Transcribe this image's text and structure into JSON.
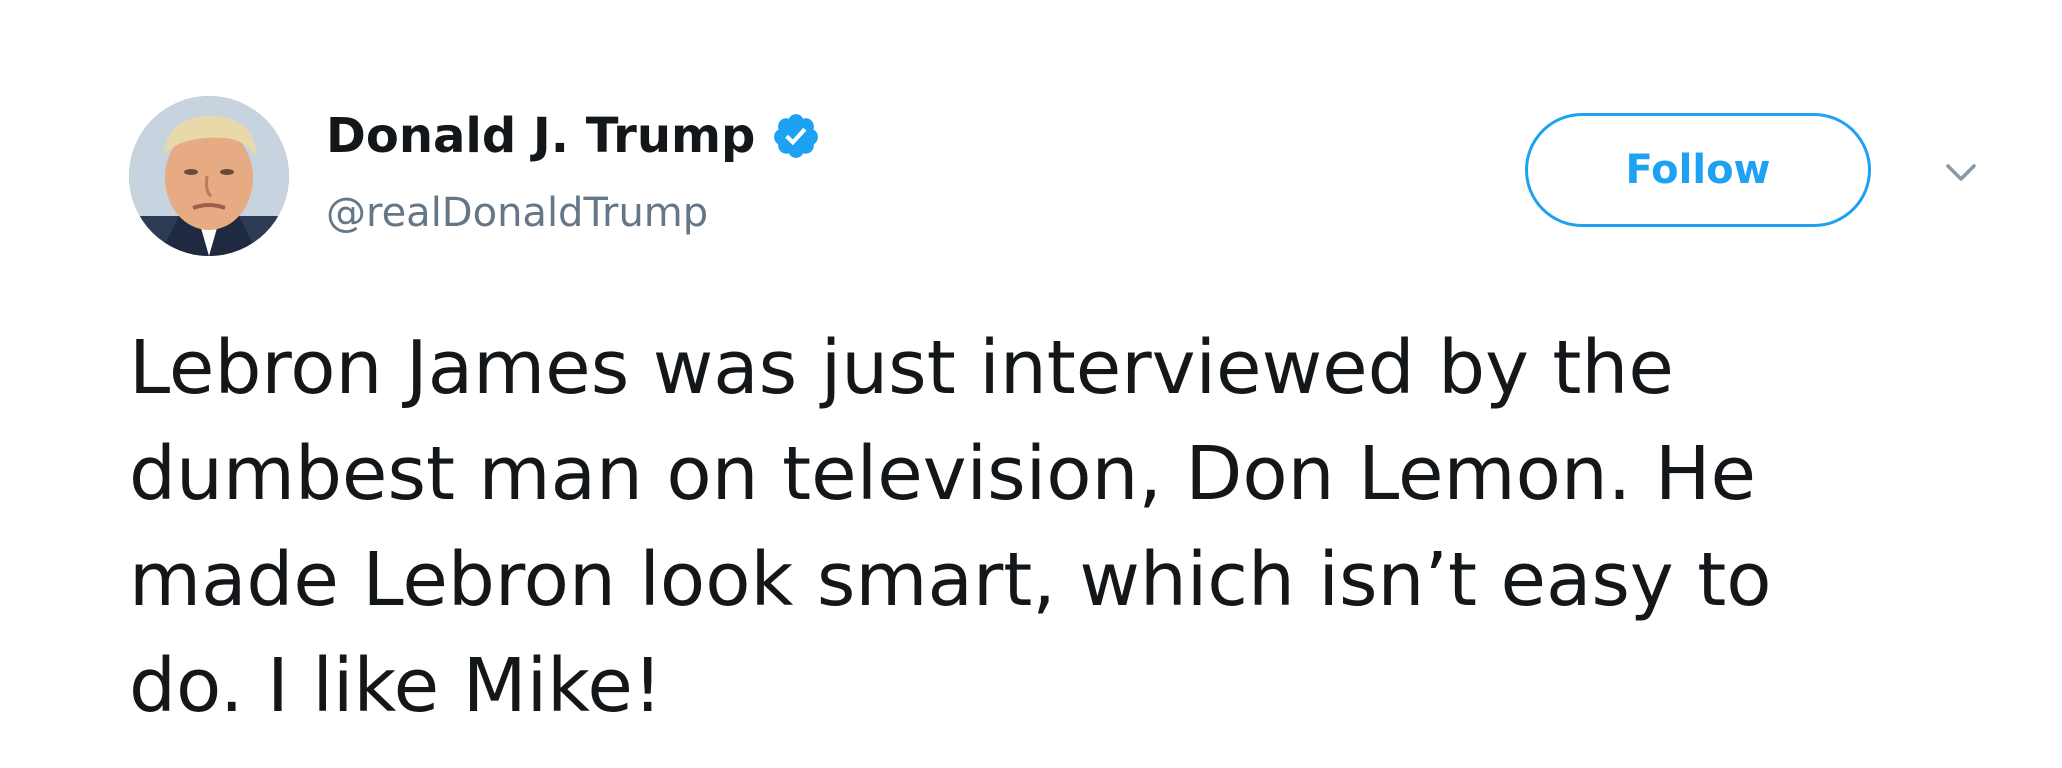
{
  "author": {
    "display_name": "Donald J. Trump",
    "handle": "@realDonaldTrump",
    "verified": true
  },
  "actions": {
    "follow_label": "Follow",
    "menu_icon": "chevron-down-icon"
  },
  "tweet": {
    "lines": [
      "Lebron James was just interviewed by the",
      "dumbest man on television, Don Lemon. He",
      "made Lebron look smart, which isn’t easy to",
      "do. I like Mike!"
    ]
  },
  "colors": {
    "accent": "#1da1f2",
    "text": "#14171a",
    "secondary_text": "#657786"
  }
}
